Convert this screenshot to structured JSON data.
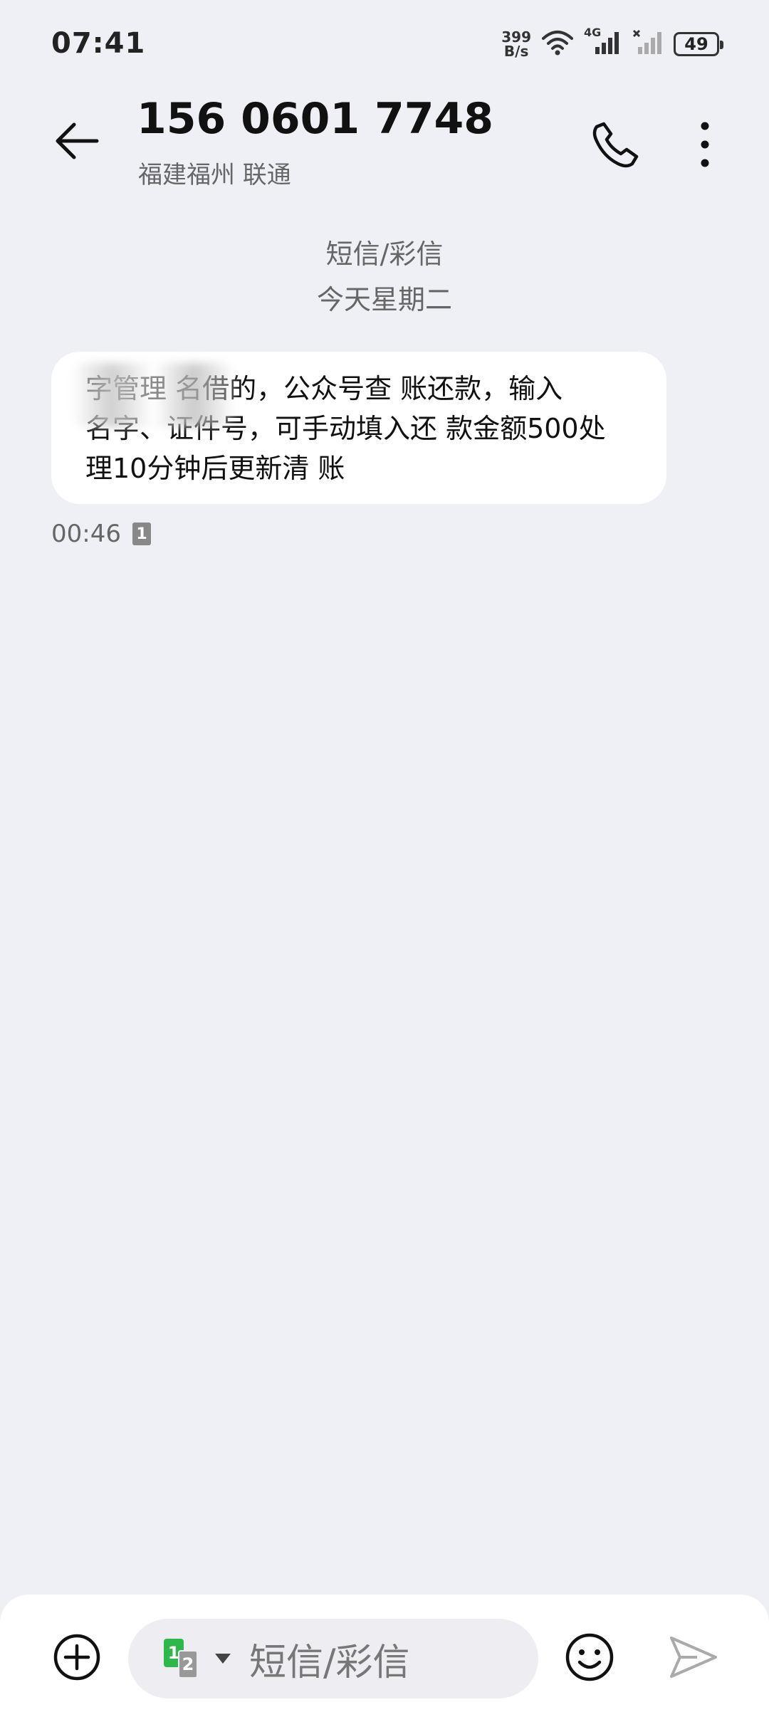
{
  "status_bar": {
    "time": "07:41",
    "net_speed_value": "399",
    "net_speed_unit": "B/s",
    "network_type": "4G",
    "battery": "49"
  },
  "header": {
    "contact_number": "156 0601 7748",
    "contact_location": "福建福州 联通"
  },
  "conversation": {
    "type_label": "短信/彩信",
    "date_label": "今天星期二"
  },
  "message": {
    "lines": [
      "字管理 名借的，公众号查 账还款，输入",
      "名字、证件号，可手动填入还 款金额500处",
      "理10分钟后更新清 账"
    ],
    "time": "00:46",
    "sim_slot": "1"
  },
  "composer": {
    "sim_primary": "1",
    "sim_secondary": "2",
    "placeholder": "短信/彩信"
  },
  "colors": {
    "background": "#eff0f5",
    "bubble": "#ffffff",
    "sim_green": "#2eb84b"
  }
}
